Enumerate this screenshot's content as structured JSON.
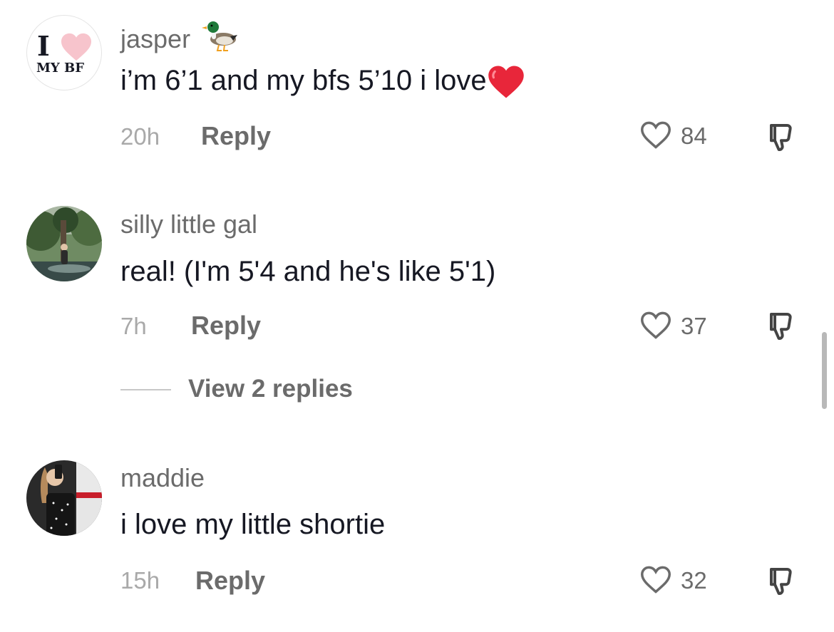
{
  "comments": [
    {
      "username": "jasper",
      "username_emoji": "duck-icon",
      "text": "i’m 6’1 and my bfs 5’10 i love",
      "text_emoji": "red-heart-icon",
      "time": "20h",
      "reply_label": "Reply",
      "likes": "84",
      "avatar": {
        "kind": "graphic",
        "line1": "I",
        "line2": "MY BF"
      }
    },
    {
      "username": "silly little gal",
      "text": "real! (I'm 5'4 and he's like 5'1)",
      "time": "7h",
      "reply_label": "Reply",
      "likes": "37",
      "view_replies": "View 2 replies",
      "avatar": {
        "kind": "photo"
      }
    },
    {
      "username": "maddie",
      "text": "i love my little shortie",
      "time": "15h",
      "reply_label": "Reply",
      "likes": "32",
      "avatar": {
        "kind": "photo"
      }
    }
  ],
  "colors": {
    "username": "#6b6b6b",
    "text": "#161823",
    "meta": "#a9a9a9",
    "heart": "#e8263a",
    "pink_heart": "#f7c4cc"
  }
}
